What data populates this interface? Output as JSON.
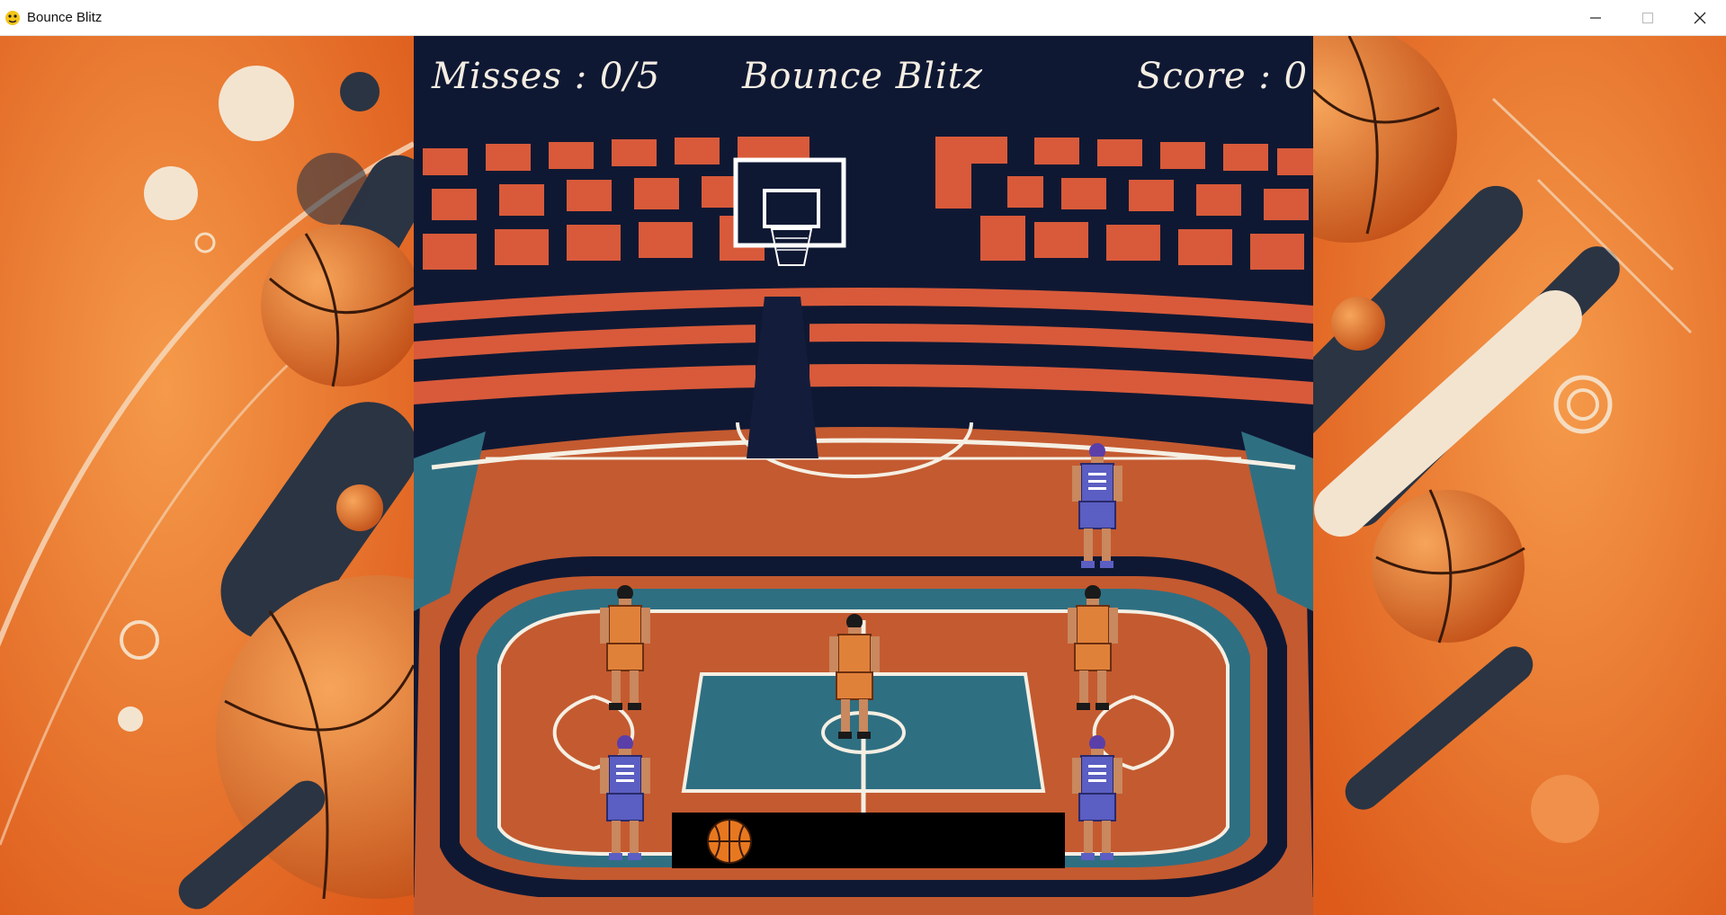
{
  "window": {
    "title": "Bounce Blitz",
    "app_icon": "pygame-snake-icon",
    "controls": [
      "minimize-icon",
      "maximize-icon",
      "close-icon"
    ]
  },
  "hud": {
    "misses": "Misses : 0/5",
    "title": "Bounce Blitz",
    "score": "Score : 0"
  },
  "game": {
    "misses_count": 0,
    "misses_max": 5,
    "score": 0,
    "players": [
      {
        "team": "orange",
        "role": "teammate"
      },
      {
        "team": "orange",
        "role": "teammate"
      },
      {
        "team": "orange",
        "role": "teammate"
      },
      {
        "team": "purple",
        "role": "defender"
      },
      {
        "team": "purple",
        "role": "defender"
      },
      {
        "team": "purple",
        "role": "defender"
      }
    ],
    "ball_tray_items": [
      "basketball-icon"
    ]
  },
  "colors": {
    "court": "#c45a30",
    "paint": "#2f6f82",
    "stands": "#d85a3a",
    "arena_dark": "#0f1833",
    "orange_jersey": "#e0813a",
    "purple_jersey": "#5b5ec2",
    "background_orange": "#e8712a"
  }
}
